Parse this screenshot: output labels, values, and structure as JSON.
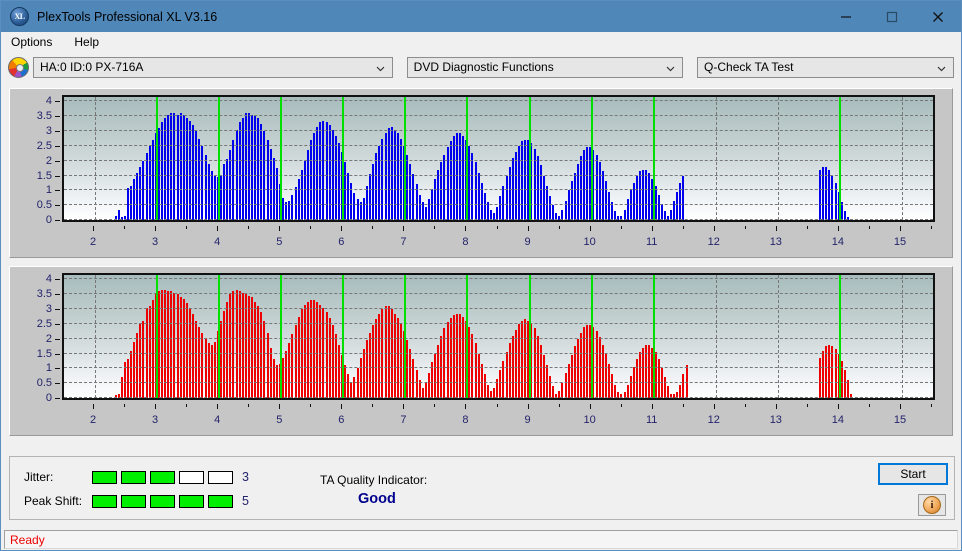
{
  "window": {
    "title": "PlexTools Professional XL V3.16",
    "app_icon": "xl-disc-icon",
    "icon_text": "XL",
    "minimize": "minimize-icon",
    "maximize": "maximize-icon",
    "close": "close-icon",
    "titlebar_color": "#4e87b8"
  },
  "menu": {
    "items": [
      {
        "label": "Options"
      },
      {
        "label": "Help"
      }
    ]
  },
  "selectors": {
    "drive_icon": "optical-disc-icon",
    "drive": {
      "value": "HA:0 ID:0  PX-716A"
    },
    "function": {
      "value": "DVD Diagnostic Functions"
    },
    "test": {
      "value": "Q-Check TA Test"
    }
  },
  "chart_data": [
    {
      "type": "bar",
      "title": "",
      "xlabel": "",
      "ylabel": "",
      "series_name": "Jitter",
      "color": "#0000ee",
      "xlim": [
        1.5,
        15.5
      ],
      "ylim": [
        0,
        4.15
      ],
      "yticks": [
        0,
        0.5,
        1,
        1.5,
        2,
        2.5,
        3,
        3.5,
        4
      ],
      "ytick_labels": [
        "0",
        "0.5",
        "1",
        "1.5",
        "2",
        "2.5",
        "3",
        "3.5",
        "4"
      ],
      "xticks": [
        2,
        3,
        4,
        5,
        6,
        7,
        8,
        9,
        10,
        11,
        12,
        13,
        14,
        15
      ],
      "xtick_labels": [
        "2",
        "3",
        "4",
        "5",
        "6",
        "7",
        "8",
        "9",
        "10",
        "11",
        "12",
        "13",
        "14",
        "15"
      ],
      "grid": true,
      "markers": [
        3,
        4,
        5,
        6,
        7,
        8,
        9,
        10,
        11,
        14
      ],
      "marker_color": "#00e000",
      "x": [
        2.33,
        2.38,
        2.43,
        2.48,
        2.53,
        2.58,
        2.63,
        2.68,
        2.73,
        2.78,
        2.83,
        2.88,
        2.93,
        2.98,
        3.03,
        3.08,
        3.13,
        3.18,
        3.23,
        3.28,
        3.33,
        3.38,
        3.43,
        3.48,
        3.53,
        3.58,
        3.63,
        3.68,
        3.73,
        3.78,
        3.83,
        3.88,
        3.93,
        3.98,
        4.03,
        4.08,
        4.13,
        4.18,
        4.23,
        4.28,
        4.33,
        4.38,
        4.43,
        4.48,
        4.53,
        4.58,
        4.63,
        4.68,
        4.73,
        4.78,
        4.83,
        4.88,
        4.93,
        4.98,
        5.03,
        5.08,
        5.13,
        5.18,
        5.23,
        5.28,
        5.33,
        5.38,
        5.43,
        5.48,
        5.53,
        5.58,
        5.63,
        5.68,
        5.73,
        5.78,
        5.83,
        5.88,
        5.93,
        5.98,
        6.03,
        6.08,
        6.13,
        6.18,
        6.23,
        6.28,
        6.33,
        6.38,
        6.43,
        6.48,
        6.53,
        6.58,
        6.63,
        6.68,
        6.73,
        6.78,
        6.83,
        6.88,
        6.93,
        6.98,
        7.03,
        7.08,
        7.13,
        7.18,
        7.23,
        7.28,
        7.33,
        7.38,
        7.43,
        7.48,
        7.53,
        7.58,
        7.63,
        7.68,
        7.73,
        7.78,
        7.83,
        7.88,
        7.93,
        7.98,
        8.03,
        8.08,
        8.13,
        8.18,
        8.23,
        8.28,
        8.33,
        8.38,
        8.43,
        8.48,
        8.53,
        8.58,
        8.63,
        8.68,
        8.73,
        8.78,
        8.83,
        8.88,
        8.93,
        8.98,
        9.03,
        9.08,
        9.13,
        9.18,
        9.23,
        9.28,
        9.33,
        9.38,
        9.43,
        9.48,
        9.53,
        9.58,
        9.63,
        9.68,
        9.73,
        9.78,
        9.83,
        9.88,
        9.93,
        9.98,
        10.03,
        10.08,
        10.13,
        10.18,
        10.23,
        10.28,
        10.33,
        10.38,
        10.43,
        10.48,
        10.53,
        10.58,
        10.63,
        10.68,
        10.73,
        10.78,
        10.83,
        10.88,
        10.93,
        10.98,
        11.03,
        11.08,
        11.13,
        11.18,
        11.23,
        11.28,
        11.33,
        11.38,
        11.43,
        11.48,
        13.68,
        13.73,
        13.78,
        13.83,
        13.88,
        13.93,
        13.98,
        14.03,
        14.08,
        14.13,
        14.18,
        14.23,
        14.28,
        14.33,
        14.38
      ],
      "values": [
        0.12,
        0.35,
        0.1,
        0.12,
        1.08,
        1.15,
        1.4,
        1.6,
        1.8,
        2.0,
        2.25,
        2.5,
        2.7,
        2.95,
        3.1,
        3.3,
        3.45,
        3.55,
        3.6,
        3.6,
        3.55,
        3.6,
        3.55,
        3.45,
        3.35,
        3.2,
        3.0,
        2.75,
        2.5,
        2.2,
        1.9,
        1.65,
        1.5,
        1.45,
        1.5,
        1.9,
        2.05,
        2.35,
        2.7,
        3.05,
        3.3,
        3.45,
        3.6,
        3.6,
        3.55,
        3.5,
        3.45,
        3.25,
        3.0,
        2.7,
        2.4,
        2.1,
        1.75,
        1.2,
        0.75,
        0.6,
        0.65,
        0.85,
        1.1,
        1.4,
        1.7,
        2.0,
        2.35,
        2.7,
        2.95,
        3.15,
        3.3,
        3.35,
        3.3,
        3.2,
        3.05,
        2.85,
        2.6,
        2.3,
        1.95,
        1.6,
        1.25,
        0.9,
        0.7,
        0.6,
        0.75,
        1.15,
        1.55,
        1.9,
        2.25,
        2.5,
        2.75,
        2.95,
        3.1,
        3.15,
        3.05,
        2.95,
        2.75,
        2.5,
        2.2,
        1.9,
        1.55,
        1.2,
        0.85,
        0.6,
        0.45,
        0.7,
        1.05,
        1.4,
        1.7,
        1.95,
        2.2,
        2.45,
        2.65,
        2.85,
        2.95,
        2.95,
        2.85,
        2.7,
        2.5,
        2.25,
        1.95,
        1.6,
        1.25,
        0.9,
        0.6,
        0.35,
        0.25,
        0.45,
        0.8,
        1.15,
        1.5,
        1.8,
        2.1,
        2.3,
        2.5,
        2.65,
        2.7,
        2.7,
        2.6,
        2.4,
        2.15,
        1.85,
        1.5,
        1.15,
        0.8,
        0.5,
        0.25,
        0.15,
        0.35,
        0.65,
        1.0,
        1.3,
        1.6,
        1.9,
        2.15,
        2.35,
        2.45,
        2.45,
        2.35,
        2.2,
        1.95,
        1.65,
        1.3,
        0.95,
        0.6,
        0.3,
        0.12,
        0.12,
        0.35,
        0.7,
        1.0,
        1.25,
        1.5,
        1.65,
        1.7,
        1.7,
        1.6,
        1.4,
        1.15,
        0.85,
        0.55,
        0.3,
        0.12,
        0.35,
        0.65,
        0.95,
        1.25,
        1.5,
        1.7,
        1.8,
        1.8,
        1.7,
        1.5,
        1.25,
        0.95,
        0.6,
        0.3,
        0.1
      ]
    },
    {
      "type": "bar",
      "title": "",
      "xlabel": "",
      "ylabel": "",
      "series_name": "Peak Shift",
      "color": "#ee0000",
      "xlim": [
        1.5,
        15.5
      ],
      "ylim": [
        0,
        4.15
      ],
      "yticks": [
        0,
        0.5,
        1,
        1.5,
        2,
        2.5,
        3,
        3.5,
        4
      ],
      "ytick_labels": [
        "0",
        "0.5",
        "1",
        "1.5",
        "2",
        "2.5",
        "3",
        "3.5",
        "4"
      ],
      "xticks": [
        2,
        3,
        4,
        5,
        6,
        7,
        8,
        9,
        10,
        11,
        12,
        13,
        14,
        15
      ],
      "xtick_labels": [
        "2",
        "3",
        "4",
        "5",
        "6",
        "7",
        "8",
        "9",
        "10",
        "11",
        "12",
        "13",
        "14",
        "15"
      ],
      "grid": true,
      "markers": [
        3,
        4,
        5,
        6,
        7,
        8,
        9,
        10,
        11,
        14
      ],
      "marker_color": "#00e000",
      "x": [
        2.33,
        2.38,
        2.43,
        2.48,
        2.53,
        2.58,
        2.63,
        2.68,
        2.73,
        2.78,
        2.83,
        2.88,
        2.93,
        2.98,
        3.03,
        3.08,
        3.13,
        3.18,
        3.23,
        3.28,
        3.33,
        3.38,
        3.43,
        3.48,
        3.53,
        3.58,
        3.63,
        3.68,
        3.73,
        3.78,
        3.83,
        3.88,
        3.93,
        3.98,
        4.03,
        4.08,
        4.13,
        4.18,
        4.23,
        4.28,
        4.33,
        4.38,
        4.43,
        4.48,
        4.53,
        4.58,
        4.63,
        4.68,
        4.73,
        4.78,
        4.83,
        4.88,
        4.93,
        4.98,
        5.03,
        5.08,
        5.13,
        5.18,
        5.23,
        5.28,
        5.33,
        5.38,
        5.43,
        5.48,
        5.53,
        5.58,
        5.63,
        5.68,
        5.73,
        5.78,
        5.83,
        5.88,
        5.93,
        5.98,
        6.03,
        6.08,
        6.13,
        6.18,
        6.23,
        6.28,
        6.33,
        6.38,
        6.43,
        6.48,
        6.53,
        6.58,
        6.63,
        6.68,
        6.73,
        6.78,
        6.83,
        6.88,
        6.93,
        6.98,
        7.03,
        7.08,
        7.13,
        7.18,
        7.23,
        7.28,
        7.33,
        7.38,
        7.43,
        7.48,
        7.53,
        7.58,
        7.63,
        7.68,
        7.73,
        7.78,
        7.83,
        7.88,
        7.93,
        7.98,
        8.03,
        8.08,
        8.13,
        8.18,
        8.23,
        8.28,
        8.33,
        8.38,
        8.43,
        8.48,
        8.53,
        8.58,
        8.63,
        8.68,
        8.73,
        8.78,
        8.83,
        8.88,
        8.93,
        8.98,
        9.03,
        9.08,
        9.13,
        9.18,
        9.23,
        9.28,
        9.33,
        9.38,
        9.43,
        9.48,
        9.53,
        9.58,
        9.63,
        9.68,
        9.73,
        9.78,
        9.83,
        9.88,
        9.93,
        9.98,
        10.03,
        10.08,
        10.13,
        10.18,
        10.23,
        10.28,
        10.33,
        10.38,
        10.43,
        10.48,
        10.53,
        10.58,
        10.63,
        10.68,
        10.73,
        10.78,
        10.83,
        10.88,
        10.93,
        10.98,
        11.03,
        11.08,
        11.13,
        11.18,
        11.23,
        11.28,
        11.33,
        11.38,
        11.43,
        11.48,
        11.53,
        13.68,
        13.73,
        13.78,
        13.83,
        13.88,
        13.93,
        13.98,
        14.03,
        14.08,
        14.13,
        14.18,
        14.23,
        14.28,
        14.33,
        14.38,
        14.58
      ],
      "values": [
        0.1,
        0.12,
        0.72,
        1.2,
        1.3,
        1.6,
        1.9,
        2.2,
        2.5,
        2.6,
        3.05,
        3.1,
        3.3,
        3.5,
        3.6,
        3.65,
        3.65,
        3.6,
        3.6,
        3.55,
        3.5,
        3.4,
        3.35,
        3.2,
        3.05,
        2.85,
        2.6,
        2.4,
        2.2,
        2.0,
        1.85,
        1.8,
        1.9,
        2.25,
        2.6,
        2.95,
        3.25,
        3.5,
        3.6,
        3.65,
        3.6,
        3.55,
        3.5,
        3.45,
        3.4,
        3.25,
        3.1,
        2.9,
        2.6,
        2.2,
        1.7,
        1.3,
        1.1,
        1.15,
        1.35,
        1.6,
        1.85,
        2.15,
        2.45,
        2.75,
        3.0,
        3.15,
        3.25,
        3.3,
        3.3,
        3.25,
        3.15,
        3.05,
        2.9,
        2.7,
        2.45,
        2.15,
        1.8,
        1.45,
        1.1,
        0.8,
        0.55,
        0.7,
        1.0,
        1.35,
        1.65,
        1.95,
        2.2,
        2.45,
        2.65,
        2.85,
        3.0,
        3.1,
        3.1,
        3.0,
        2.85,
        2.7,
        2.5,
        2.25,
        1.95,
        1.65,
        1.3,
        0.95,
        0.6,
        0.35,
        0.55,
        0.85,
        1.2,
        1.5,
        1.8,
        2.1,
        2.35,
        2.55,
        2.7,
        2.8,
        2.85,
        2.85,
        2.75,
        2.6,
        2.4,
        2.15,
        1.85,
        1.5,
        1.15,
        0.8,
        0.45,
        0.25,
        0.35,
        0.65,
        0.95,
        1.25,
        1.55,
        1.85,
        2.1,
        2.3,
        2.5,
        2.6,
        2.65,
        2.6,
        2.5,
        2.35,
        2.1,
        1.8,
        1.45,
        1.1,
        0.75,
        0.4,
        0.15,
        0.25,
        0.5,
        0.85,
        1.15,
        1.45,
        1.75,
        2.0,
        2.2,
        2.4,
        2.45,
        2.45,
        2.4,
        2.25,
        2.05,
        1.8,
        1.5,
        1.15,
        0.8,
        0.45,
        0.2,
        0.12,
        0.2,
        0.45,
        0.75,
        1.05,
        1.3,
        1.55,
        1.7,
        1.8,
        1.8,
        1.7,
        1.55,
        1.3,
        1.0,
        0.7,
        0.4,
        0.15,
        0.15,
        0.2,
        0.45,
        0.8,
        1.1,
        1.35,
        1.6,
        1.75,
        1.8,
        1.75,
        1.65,
        1.5,
        1.25,
        0.95,
        0.6,
        0.15
      ]
    }
  ],
  "metrics": {
    "jitter": {
      "label": "Jitter:",
      "filled": 3,
      "total": 5,
      "value": "3"
    },
    "peak_shift": {
      "label": "Peak Shift:",
      "filled": 5,
      "total": 5,
      "value": "5"
    }
  },
  "quality": {
    "label": "TA Quality Indicator:",
    "value": "Good",
    "color": "#00008f"
  },
  "actions": {
    "start": "Start",
    "info_icon": "info-icon",
    "info_glyph": "i"
  },
  "status": {
    "text": "Ready",
    "color": "#ee0000"
  }
}
